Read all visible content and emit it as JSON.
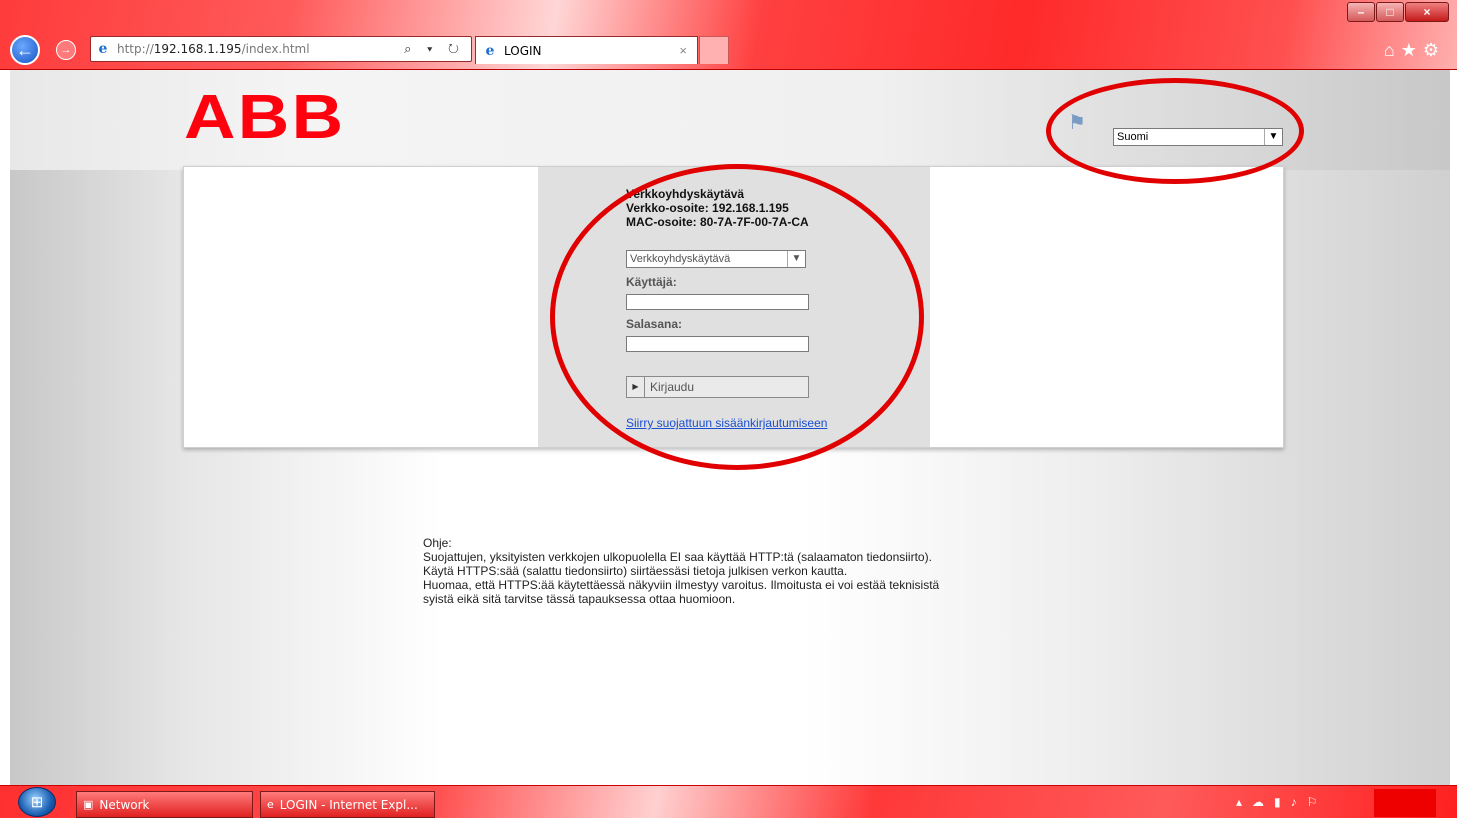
{
  "browser": {
    "url_prefix": "http://",
    "url_host": "192.168.1.195",
    "url_path": "/index.html",
    "tab_title": "LOGIN",
    "tab_close": "×",
    "search_refresh": "⌕ ▾ ↻"
  },
  "window_controls": {
    "minimize": "–",
    "maximize": "□",
    "close": "×"
  },
  "logo": "ABB",
  "language": {
    "selected": "Suomi"
  },
  "device": {
    "title": "Verkkoyhdyskäytävä",
    "ip_line": "Verkko-osoite: 192.168.1.195",
    "mac_line": "MAC-osoite: 80-7A-7F-00-7A-CA"
  },
  "form": {
    "type_selected": "Verkkoyhdyskäytävä",
    "user_label": "Käyttäjä:",
    "password_label": "Salasana:",
    "login_button": "Kirjaudu",
    "secure_link": "Siirry suojattuun sisäänkirjautumiseen"
  },
  "help": {
    "heading": "Ohje:",
    "line1": "Suojattujen, yksityisten verkkojen ulkopuolella EI saa käyttää HTTP:tä (salaamaton tiedonsiirto).",
    "line2": "Käytä HTTPS:sää (salattu tiedonsiirto) siirtäessäsi tietoja julkisen verkon kautta.",
    "line3": "Huomaa, että HTTPS:ää käytettäessä näkyviin ilmestyy varoitus. Ilmoitusta ei voi estää teknisistä",
    "line4": "syistä eikä sitä tarvitse tässä tapauksessa ottaa huomioon."
  },
  "taskbar": {
    "items": [
      {
        "label": "Network"
      },
      {
        "label": "LOGIN - Internet Expl..."
      }
    ]
  },
  "icons": [
    "back-arrow-icon",
    "forward-arrow-icon",
    "ie-icon",
    "search-icon",
    "refresh-icon",
    "home-icon",
    "favorites-star-icon",
    "settings-gear-icon",
    "language-flag-icon",
    "chevron-down-icon",
    "play-arrow-icon",
    "windows-start-icon",
    "network-icon",
    "tray-arrow-icon",
    "tray-network-icon",
    "tray-power-icon",
    "tray-volume-icon",
    "tray-flag-icon"
  ]
}
